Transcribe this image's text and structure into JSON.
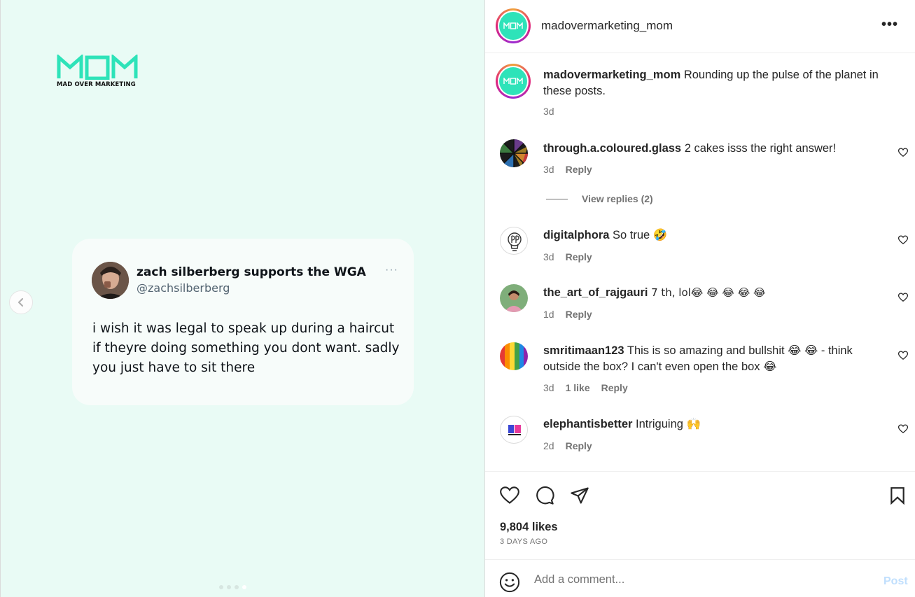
{
  "media": {
    "logo_text": "MOM",
    "logo_subtitle": "MAD OVER MARKETING",
    "tweet": {
      "display_name": "zach silberberg supports the WGA",
      "handle": "@zachsilberberg",
      "more": "···",
      "text": "i wish it was legal to speak up during a haircut if theyre doing something you dont want. sadly you just have to sit there"
    },
    "carousel": {
      "slide_count": 4,
      "active_index": 3
    },
    "brand_color": "#2ee3b9",
    "background_color": "#e9fbf5"
  },
  "post": {
    "header": {
      "username": "madovermarketing_mom",
      "avatar_text": "MOM",
      "more": "•••"
    },
    "caption": {
      "username": "madovermarketing_mom",
      "text": "Rounding up the pulse of the planet in these posts.",
      "time": "3d"
    },
    "comments": [
      {
        "username": "through.a.coloured.glass",
        "text": "2 cakes isss the right answer!",
        "time": "3d",
        "reply": "Reply"
      },
      {
        "username": "digitalphora",
        "text": "So true 🤣",
        "time": "3d",
        "reply": "Reply"
      },
      {
        "username": "the_art_of_rajgauri",
        "text": "7 th, lol😂 😂 😂 😂 😂",
        "time": "1d",
        "reply": "Reply"
      },
      {
        "username": "smritimaan123",
        "text": "This is so amazing and bullshit 😂 😂 - think outside the box? I can't even open the box 😂",
        "time": "3d",
        "likes": "1 like",
        "reply": "Reply"
      },
      {
        "username": "elephantisbetter",
        "text": "Intriguing 🙌",
        "time": "2d",
        "reply": "Reply"
      }
    ],
    "view_replies": "View replies (2)",
    "likes": "9,804 likes",
    "posted_ago": "3 DAYS AGO",
    "comment_box": {
      "placeholder": "Add a comment...",
      "post_label": "Post"
    },
    "icons": {
      "like": "heart-icon",
      "comment": "comment-bubble-icon",
      "share": "paper-plane-icon",
      "save": "bookmark-icon",
      "emoji": "smiley-icon"
    }
  }
}
